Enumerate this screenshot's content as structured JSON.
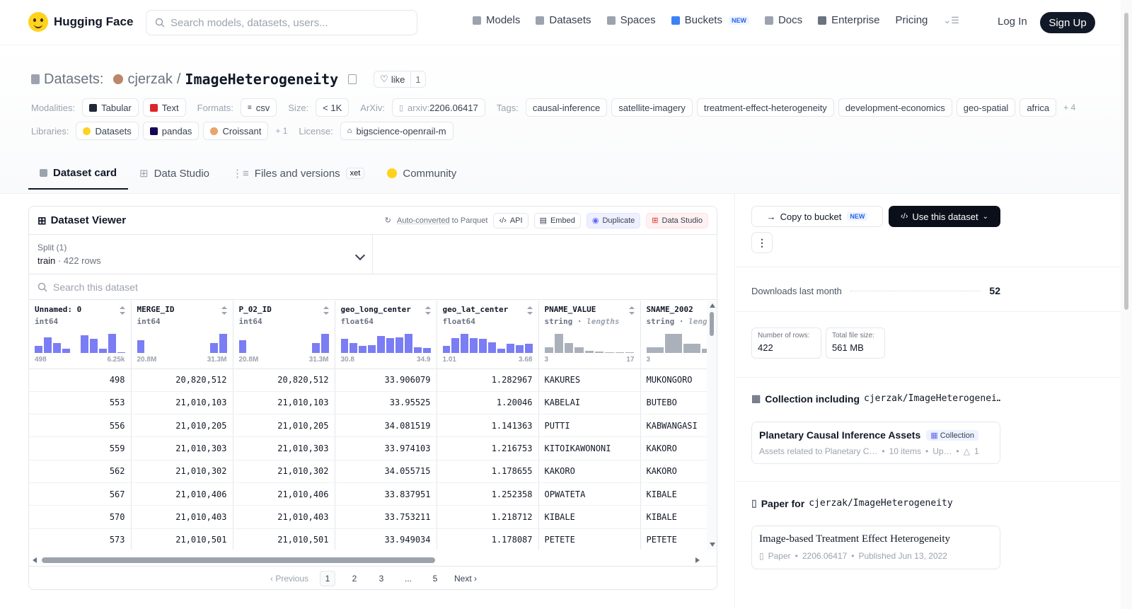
{
  "nav": {
    "brand": "Hugging Face",
    "search_placeholder": "Search models, datasets, users...",
    "links": [
      {
        "label": "Models",
        "icon": "cube-icon"
      },
      {
        "label": "Datasets",
        "icon": "database-icon"
      },
      {
        "label": "Spaces",
        "icon": "grid-icon"
      },
      {
        "label": "Buckets",
        "icon": "bucket-icon",
        "badge": "NEW"
      },
      {
        "label": "Docs",
        "icon": "book-icon"
      },
      {
        "label": "Enterprise",
        "icon": "enterprise-icon"
      },
      {
        "label": "Pricing"
      }
    ],
    "login": "Log In",
    "signup": "Sign Up"
  },
  "header": {
    "section": "Datasets:",
    "owner": "cjerzak",
    "separator": "/",
    "name": "ImageHeterogeneity",
    "like_label": "like",
    "like_count": "1",
    "modalities_label": "Modalities:",
    "modalities": [
      "Tabular",
      "Text"
    ],
    "formats_label": "Formats:",
    "formats": [
      "csv"
    ],
    "size_label": "Size:",
    "size": "< 1K",
    "arxiv_label": "ArXiv:",
    "arxiv_prefix": "arxiv:",
    "arxiv": "2206.06417",
    "tags_label": "Tags:",
    "tags": [
      "causal-inference",
      "satellite-imagery",
      "treatment-effect-heterogeneity",
      "development-economics",
      "geo-spatial",
      "africa"
    ],
    "tags_more": "+ 4",
    "libraries_label": "Libraries:",
    "libraries": [
      "Datasets",
      "pandas",
      "Croissant"
    ],
    "libraries_more": "+ 1",
    "license_label": "License:",
    "license": "bigscience-openrail-m"
  },
  "tabs": [
    {
      "label": "Dataset card",
      "active": true
    },
    {
      "label": "Data Studio"
    },
    {
      "label": "Files and versions",
      "badge": "xet"
    },
    {
      "label": "Community"
    }
  ],
  "viewer": {
    "title": "Dataset Viewer",
    "auto_converted": "Auto-converted",
    "to_parquet": "to Parquet",
    "buttons": [
      "API",
      "Embed",
      "Duplicate",
      "Data Studio"
    ],
    "split_label": "Split (1)",
    "split_name": "train",
    "split_rows": "422 rows",
    "search_placeholder": "Search this dataset",
    "columns": [
      {
        "name": "Unnamed: 0",
        "type": "int64",
        "min": "498",
        "max": "6.25k",
        "hist": [
          0.35,
          0.8,
          0.5,
          0.2,
          0,
          0.9,
          0.7,
          0.2,
          0.95,
          0.05
        ]
      },
      {
        "name": "MERGE_ID",
        "type": "int64",
        "min": "20.8M",
        "max": "31.3M",
        "hist": [
          0.65,
          0,
          0,
          0,
          0,
          0,
          0,
          0,
          0.5,
          0.95
        ]
      },
      {
        "name": "P_02_ID",
        "type": "int64",
        "min": "20.8M",
        "max": "31.3M",
        "hist": [
          0.65,
          0,
          0,
          0,
          0,
          0,
          0,
          0,
          0.5,
          0.95
        ]
      },
      {
        "name": "geo_long_center",
        "type": "float64",
        "min": "30.8",
        "max": "34.9",
        "hist": [
          0.7,
          0.5,
          0.35,
          0.4,
          0.85,
          0.75,
          0.8,
          0.95,
          0.3,
          0.25
        ]
      },
      {
        "name": "geo_lat_center",
        "type": "float64",
        "min": "1.01",
        "max": "3.68",
        "hist": [
          0.35,
          0.75,
          0.95,
          0.75,
          0.7,
          0.55,
          0.2,
          0.45,
          0.4,
          0.45
        ]
      },
      {
        "name": "PNAME_VALUE",
        "type": "string",
        "type_suffix": "lengths",
        "min": "3",
        "max": "17",
        "hist": [
          0.3,
          0.95,
          0.5,
          0.3,
          0.12,
          0.08,
          0.04,
          0.03,
          0.02
        ]
      },
      {
        "name": "SNAME_2002",
        "type": "string",
        "type_suffix": "leng",
        "min": "3",
        "max": "",
        "hist": [
          0.3,
          0.95,
          0.45,
          0.2,
          0.08
        ]
      }
    ],
    "rows": [
      [
        "498",
        "20,820,512",
        "20,820,512",
        "33.906079",
        "1.282967",
        "KAKURES",
        "MUKONGORO"
      ],
      [
        "553",
        "21,010,103",
        "21,010,103",
        "33.95525",
        "1.20046",
        "KABELAI",
        "BUTEBO"
      ],
      [
        "556",
        "21,010,205",
        "21,010,205",
        "34.081519",
        "1.141363",
        "PUTTI",
        "KABWANGASI"
      ],
      [
        "559",
        "21,010,303",
        "21,010,303",
        "33.974103",
        "1.216753",
        "KITOIKAWONONI",
        "KAKORO"
      ],
      [
        "562",
        "21,010,302",
        "21,010,302",
        "34.055715",
        "1.178655",
        "KAKORO",
        "KAKORO"
      ],
      [
        "567",
        "21,010,406",
        "21,010,406",
        "33.837951",
        "1.252358",
        "OPWATETA",
        "KIBALE"
      ],
      [
        "570",
        "21,010,403",
        "21,010,403",
        "33.753211",
        "1.218712",
        "KIBALE",
        "KIBALE"
      ],
      [
        "573",
        "21,010,501",
        "21,010,501",
        "33.949034",
        "1.178087",
        "PETETE",
        "PETETE"
      ]
    ],
    "pager": {
      "previous": "Previous",
      "pages": [
        "1",
        "2",
        "3",
        "...",
        "5"
      ],
      "current": "1",
      "next": "Next"
    }
  },
  "sidebar": {
    "copy_to_bucket": "Copy to bucket",
    "copy_badge": "NEW",
    "use_dataset": "Use this dataset",
    "more": "⋮",
    "downloads_label": "Downloads last month",
    "downloads": "52",
    "rows_label": "Number of rows:",
    "rows": "422",
    "filesize_label": "Total file size:",
    "filesize": "561 MB",
    "collection_head": "Collection including",
    "collection_repo": "cjerzak/ImageHeterogenei…",
    "collection": {
      "title": "Planetary Causal Inference Assets",
      "badge": "Collection",
      "desc": "Assets related to Planetary C…",
      "items": "10 items",
      "updated": "Up…",
      "upvotes": "1"
    },
    "paper_head": "Paper for",
    "paper_repo": "cjerzak/ImageHeterogeneity",
    "paper": {
      "title": "Image-based Treatment Effect Heterogeneity",
      "type": "Paper",
      "id": "2206.06417",
      "published": "Published Jun 13, 2022"
    }
  }
}
